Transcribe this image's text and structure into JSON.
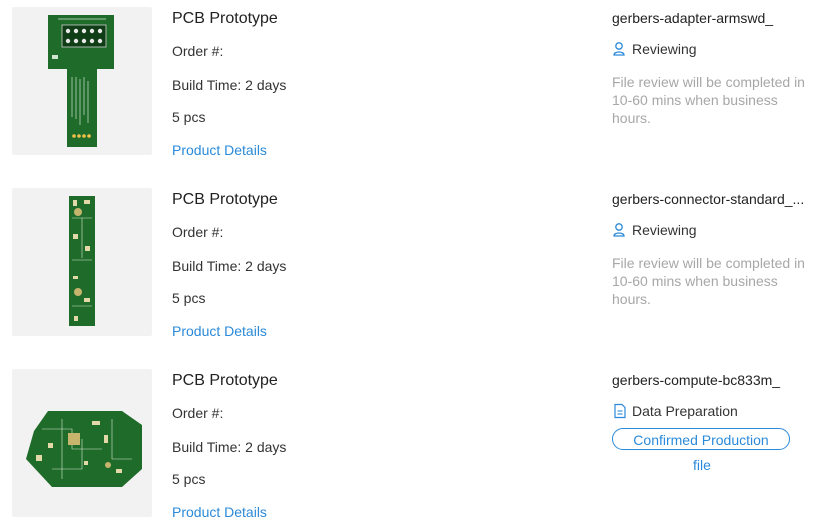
{
  "orders": [
    {
      "title": "PCB Prototype",
      "order_label": "Order #:",
      "build_time": "Build Time: 2 days",
      "quantity": "5 pcs",
      "details_link": "Product Details",
      "filename": "gerbers-adapter-armswd_",
      "status_label": "Reviewing",
      "status_icon": "user-check-icon",
      "note": "File review will be completed in 10-60 mins when business hours."
    },
    {
      "title": "PCB Prototype",
      "order_label": "Order #:",
      "build_time": "Build Time: 2 days",
      "quantity": "5 pcs",
      "details_link": "Product Details",
      "filename": "gerbers-connector-standard_...",
      "status_label": "Reviewing",
      "status_icon": "user-check-icon",
      "note": "File review will be completed in 10-60 mins when business hours."
    },
    {
      "title": "PCB Prototype",
      "order_label": "Order #:",
      "build_time": "Build Time: 2 days",
      "quantity": "5 pcs",
      "details_link": "Product Details",
      "filename": "gerbers-compute-bc833m_",
      "status_label": "Data Preparation",
      "status_icon": "document-icon",
      "confirm_button": "Confirmed Production",
      "confirm_button_line2": "file"
    }
  ],
  "colors": {
    "link": "#2b8ad9",
    "muted": "#a7a7a7",
    "pcb_green": "#1f6b2a",
    "thumb_bg": "#f2f2f2"
  }
}
